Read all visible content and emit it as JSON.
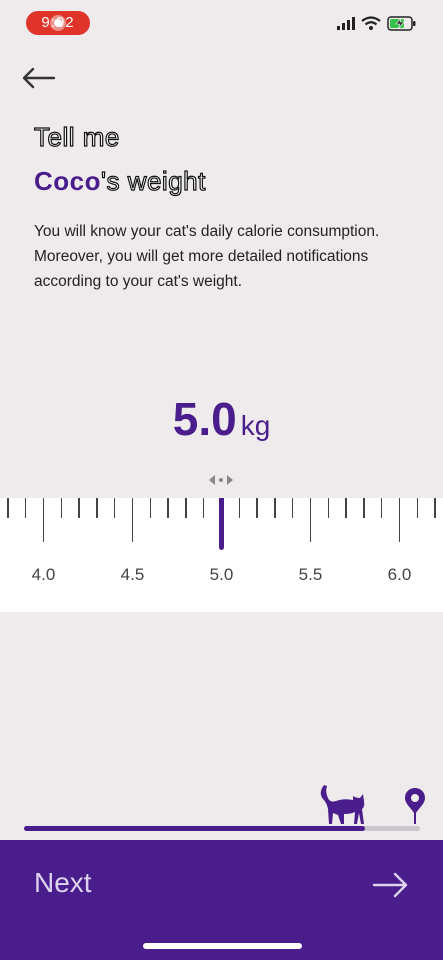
{
  "status_bar": {
    "time": "9:02"
  },
  "header": {
    "title_line1": "Tell me",
    "pet_name": "Coco",
    "title_suffix": "'s weight"
  },
  "description": "You will know your cat's daily calorie consumption. Moreover, you will get more detailed notifications according to your cat's weight.",
  "weight": {
    "value": "5.0",
    "unit": "kg"
  },
  "ruler": {
    "labels": [
      "4.0",
      "4.5",
      "5.0",
      "5.5",
      "6.0"
    ],
    "selected": 5.0,
    "step": 0.1
  },
  "progress": {
    "fraction": 0.86
  },
  "footer": {
    "next_label": "Next"
  },
  "colors": {
    "accent": "#4a1d8c",
    "background": "#efebec",
    "record": "#e0342b"
  },
  "icons": [
    "back-arrow-icon",
    "cellular-signal-icon",
    "wifi-icon",
    "battery-charging-icon",
    "drag-hint-icon",
    "cat-icon",
    "location-pin-icon",
    "forward-arrow-icon"
  ]
}
